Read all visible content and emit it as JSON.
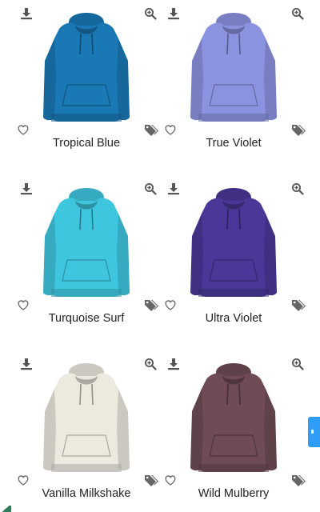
{
  "products": [
    {
      "name": "Tropical Blue",
      "color": "#1a78b4"
    },
    {
      "name": "True Violet",
      "color": "#8b93e0"
    },
    {
      "name": "Turquoise Surf",
      "color": "#3ec6df"
    },
    {
      "name": "Ultra Violet",
      "color": "#4a3798"
    },
    {
      "name": "Vanilla Milkshake",
      "color": "#ece9df"
    },
    {
      "name": "Wild Mulberry",
      "color": "#6e4b55"
    }
  ],
  "icons": {
    "download": "download-icon",
    "zoom": "zoom-in-icon",
    "wishlist": "heart-icon",
    "tags": "tags-icon"
  },
  "accent_color": "#2f9df5"
}
